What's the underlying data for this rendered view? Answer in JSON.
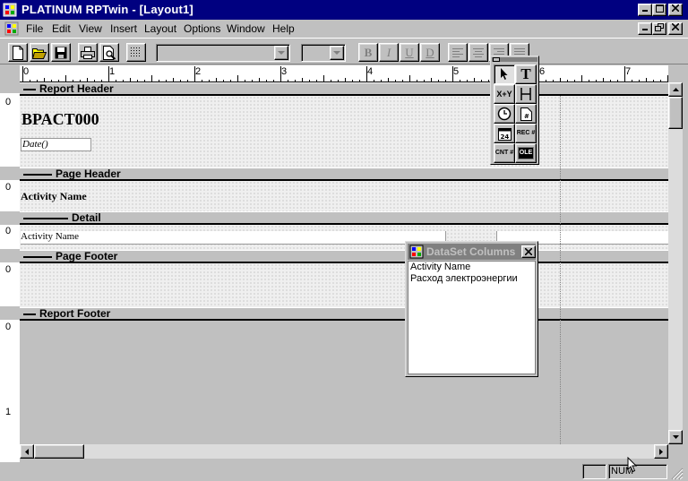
{
  "window": {
    "title": "PLATINUM RPTwin - [Layout1]",
    "caption_buttons": [
      "minimize",
      "maximize",
      "close"
    ]
  },
  "menu": {
    "items": [
      {
        "label": "File"
      },
      {
        "label": "Edit"
      },
      {
        "label": "View"
      },
      {
        "label": "Insert"
      },
      {
        "label": "Layout"
      },
      {
        "label": "Options"
      },
      {
        "label": "Window"
      },
      {
        "label": "Help"
      }
    ]
  },
  "toolbar": {
    "buttons": [
      "new-file-icon",
      "open-folder-icon",
      "save-disk-icon",
      "print-icon",
      "print-preview-icon",
      "grid-icon"
    ],
    "font_name_value": "",
    "font_size_value": "",
    "format_buttons": {
      "bold": "B",
      "italic": "I",
      "underline": "U",
      "strike": "D"
    },
    "align_buttons": [
      "align-left-icon",
      "align-center-icon",
      "align-right-icon",
      "justify-icon"
    ]
  },
  "ruler": {
    "marks": [
      "0",
      "1",
      "2",
      "3",
      "4",
      "5",
      "6",
      "7"
    ],
    "vertical_marks": [
      "0",
      "0",
      "0",
      "0",
      "0",
      "1"
    ]
  },
  "bands": {
    "report_header": {
      "label": "Report Header",
      "title_field": "BPACT000",
      "date_field": "Date()"
    },
    "page_header": {
      "label": "Page Header",
      "activity_label": "Activity Name"
    },
    "detail": {
      "label": "Detail",
      "activity_field": "Activity Name"
    },
    "page_footer": {
      "label": "Page Footer"
    },
    "report_footer": {
      "label": "Report Footer"
    }
  },
  "toolbox": {
    "tools": [
      {
        "name": "pointer-tool",
        "label": ""
      },
      {
        "name": "text-tool",
        "label": "T"
      },
      {
        "name": "formula-tool",
        "label": "X+Y"
      },
      {
        "name": "line-tool",
        "label": ""
      },
      {
        "name": "time-tool",
        "label": ""
      },
      {
        "name": "page-number-tool",
        "label": "#"
      },
      {
        "name": "date-tool",
        "label": "24"
      },
      {
        "name": "record-number-tool",
        "label": "REC #"
      },
      {
        "name": "count-tool",
        "label": "CNT #"
      },
      {
        "name": "ole-tool",
        "label": "OLE"
      }
    ]
  },
  "dataset_window": {
    "title": "DataSet Columns",
    "columns": [
      "Activity Name",
      "Расход электроэнергии"
    ]
  },
  "status": {
    "num_indicator": "NUM"
  },
  "colors": {
    "titlebar": "#000080",
    "face": "#c0c0c0",
    "band_area": "#efefef"
  }
}
